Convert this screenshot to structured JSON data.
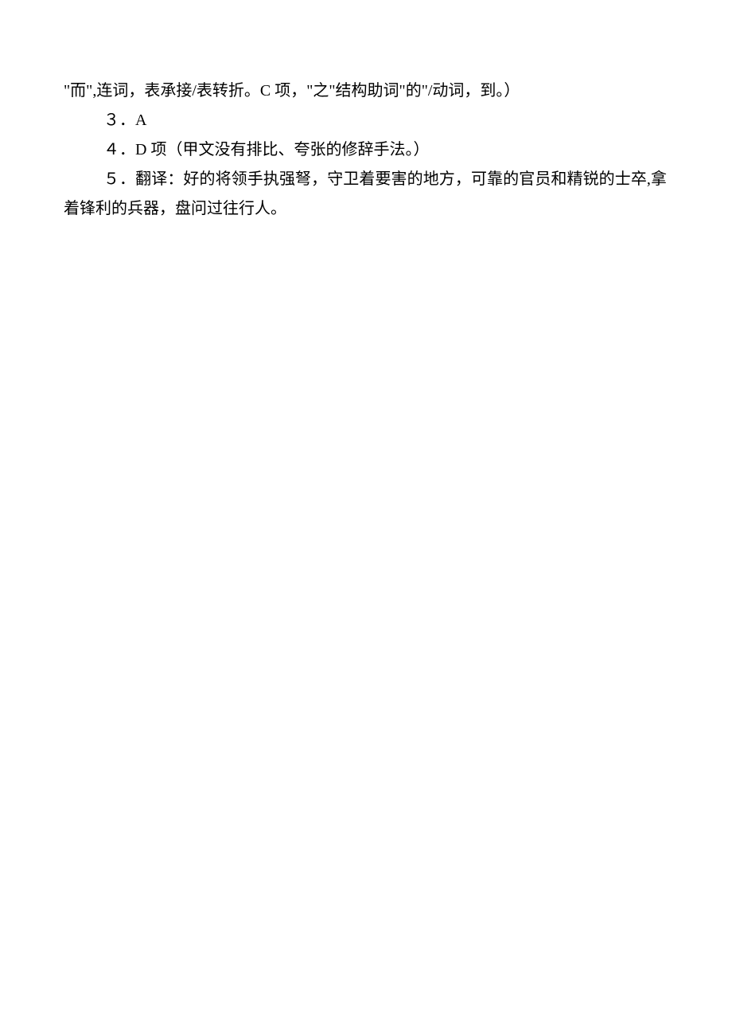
{
  "lines": {
    "l1": "\"而\",连词，表承接/表转折。C 项，\"之\"结构助词\"的\"/动词，到。）",
    "l2": "３．A",
    "l3": "４．D 项（甲文没有排比、夸张的修辞手法。）",
    "l4": "５．翻译：好的将领手执强弩，守卫着要害的地方，可靠的官员和精锐的士卒,拿着锋利的兵器，盘问过往行人。"
  }
}
